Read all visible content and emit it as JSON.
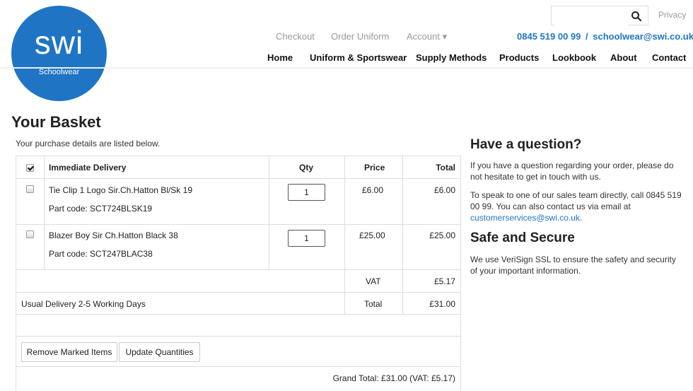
{
  "header": {
    "logo_text": "swi",
    "logo_sub": "Schoolwear",
    "search_placeholder": "",
    "privacy": "Privacy",
    "top_links": [
      "Checkout",
      "Order Uniform",
      "Account ▾"
    ],
    "phone": "0845 519 00 99",
    "separator": "/",
    "email": "schoolwear@swi.co.uk",
    "nav": [
      "Home",
      "Uniform & Sportswear",
      "Supply Methods",
      "Products",
      "Lookbook",
      "About",
      "Contact"
    ]
  },
  "basket": {
    "title": "Your Basket",
    "intro": "Your purchase details are listed below.",
    "headers": {
      "item": "Immediate Delivery",
      "qty": "Qty",
      "price": "Price",
      "total": "Total"
    },
    "items": [
      {
        "name": "Tie Clip 1 Logo Sir.Ch.Hatton Bl/Sk 19",
        "part": "Part code: SCT724BLSK19",
        "qty": "1",
        "price": "£6.00",
        "total": "£6.00"
      },
      {
        "name": "Blazer Boy Sir Ch.Hatton Black 38",
        "part": "Part code: SCT247BLAC38",
        "qty": "1",
        "price": "£25.00",
        "total": "£25.00"
      }
    ],
    "vat_label": "VAT",
    "vat_value": "£5.17",
    "delivery": "Usual Delivery 2-5 Working Days",
    "total_label": "Total",
    "total_value": "£31.00",
    "remove_button": "Remove Marked Items",
    "update_button": "Update Quantities",
    "grand_total": "Grand Total: £31.00 (VAT: £5.17)"
  },
  "sidebar": {
    "question_title": "Have a question?",
    "question_text": "If you have a question regarding your order, please do not hesitate to get in touch with us.",
    "contact_text": "To speak to one of our sales team directly, call 0845 519 00 99. You can also contact us via email at",
    "contact_email": "customerservices@swi.co.uk",
    "contact_end": ".",
    "secure_title": "Safe and Secure",
    "secure_text": "We use VeriSign SSL to ensure the safety and security of your important information."
  },
  "colors": {
    "brand": "#1f75c4",
    "border": "#dddddd"
  }
}
